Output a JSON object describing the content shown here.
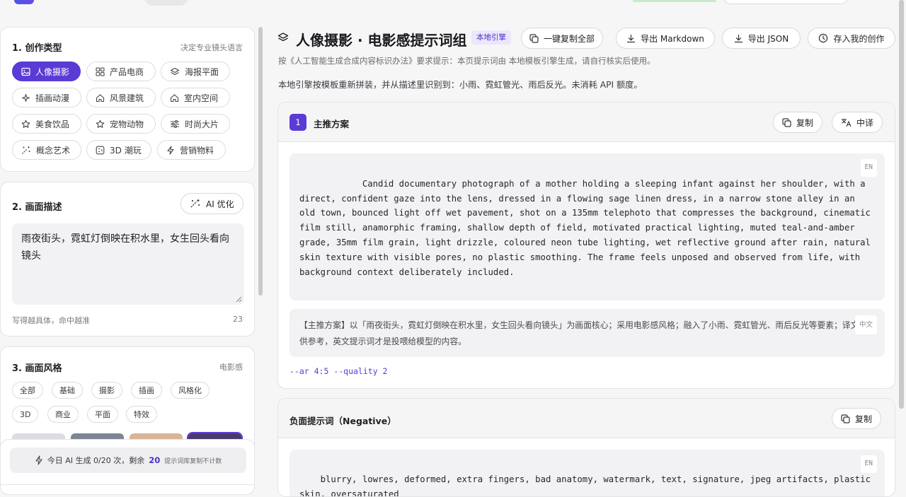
{
  "left": {
    "type_section": {
      "title": "1. 创作类型",
      "note": "决定专业镜头语言",
      "chips": [
        {
          "label": "人像摄影",
          "icon": "image-icon",
          "active": true
        },
        {
          "label": "产品电商",
          "icon": "grid-icon"
        },
        {
          "label": "海报平面",
          "icon": "layers-icon"
        },
        {
          "label": "插画动漫",
          "icon": "sparkle-icon"
        },
        {
          "label": "风景建筑",
          "icon": "home-icon"
        },
        {
          "label": "室内空间",
          "icon": "home-icon"
        },
        {
          "label": "美食饮品",
          "icon": "star-icon"
        },
        {
          "label": "宠物动物",
          "icon": "star-icon"
        },
        {
          "label": "时尚大片",
          "icon": "sliders-icon"
        },
        {
          "label": "概念艺术",
          "icon": "wand-icon"
        },
        {
          "label": "3D 潮玩",
          "icon": "box3d-icon"
        },
        {
          "label": "营销物料",
          "icon": "bolt-icon"
        }
      ]
    },
    "desc_section": {
      "title": "2. 画面描述",
      "optimize_label": "AI 优化",
      "text": "雨夜街头，霓虹灯倒映在积水里，女生回头看向镜头",
      "hint": "写得越具体，命中越准",
      "count": "23"
    },
    "style_section": {
      "title": "3. 画面风格",
      "note": "电影感",
      "tags": [
        "全部",
        "基础",
        "摄影",
        "插画",
        "风格化",
        "3D",
        "商业",
        "平面",
        "特效"
      ],
      "thumb_colors": [
        "#dcdde2",
        "#7d8593",
        "#d8b598",
        "#4a3a6a"
      ]
    },
    "quota": {
      "prefix": "今日 AI 生成 0/20 次，剩余",
      "remaining": "20",
      "suffix": "提示词库复制不计数"
    }
  },
  "right": {
    "title": "人像摄影 · 电影感提示词组",
    "engine_badge": "本地引擎",
    "actions": [
      {
        "label": "一键复制全部",
        "icon": "copy-icon"
      },
      {
        "label": "导出 Markdown",
        "icon": "download-icon"
      },
      {
        "label": "导出 JSON",
        "icon": "download-icon"
      },
      {
        "label": "存入我的创作",
        "icon": "clock-icon"
      }
    ],
    "notice": "按《人工智能生成合成内容标识办法》要求提示：本页提示词由 本地模板引擎生成，请自行核实后使用。",
    "engine_info": "本地引擎按模板重新拼装，并从描述里识别到：小雨、霓虹管光、雨后反光。未消耗 API 额度。",
    "main_card": {
      "number": "1",
      "title": "主推方案",
      "copy_label": "复制",
      "translate_label": "中译",
      "lang_en": "EN",
      "prompt_en": "        Candid documentary photograph of a mother holding a sleeping infant against her shoulder, with a direct, confident gaze into the lens, dressed in a flowing sage linen dress, in a narrow stone alley in an old town, bounced light off wet pavement, shot on a 135mm telephoto that compresses the background, cinematic film still, anamorphic framing, shallow depth of field, motivated practical lighting, muted teal-and-amber grade, 35mm film grain, light drizzle, coloured neon tube lighting, wet reflective ground after rain, natural skin texture with visible pores, no plastic smoothing. The frame feels unposed and observed from life, with background context deliberately included.",
      "lang_zh": "中文",
      "prompt_zh": "【主推方案】以「雨夜街头，霓虹灯倒映在积水里，女生回头看向镜头」为画面核心；采用电影感风格；融入了小雨、霓虹管光、雨后反光等要素；译文仅供参考，英文提示词才是投喂给模型的内容。",
      "params": "--ar 4:5 --quality 2"
    },
    "negative_card": {
      "title": "负面提示词（Negative）",
      "copy_label": "复制",
      "lang_en": "EN",
      "text": "blurry, lowres, deformed, extra fingers, bad anatomy, watermark, text, signature, jpeg artifacts, plastic skin, oversaturated"
    }
  }
}
